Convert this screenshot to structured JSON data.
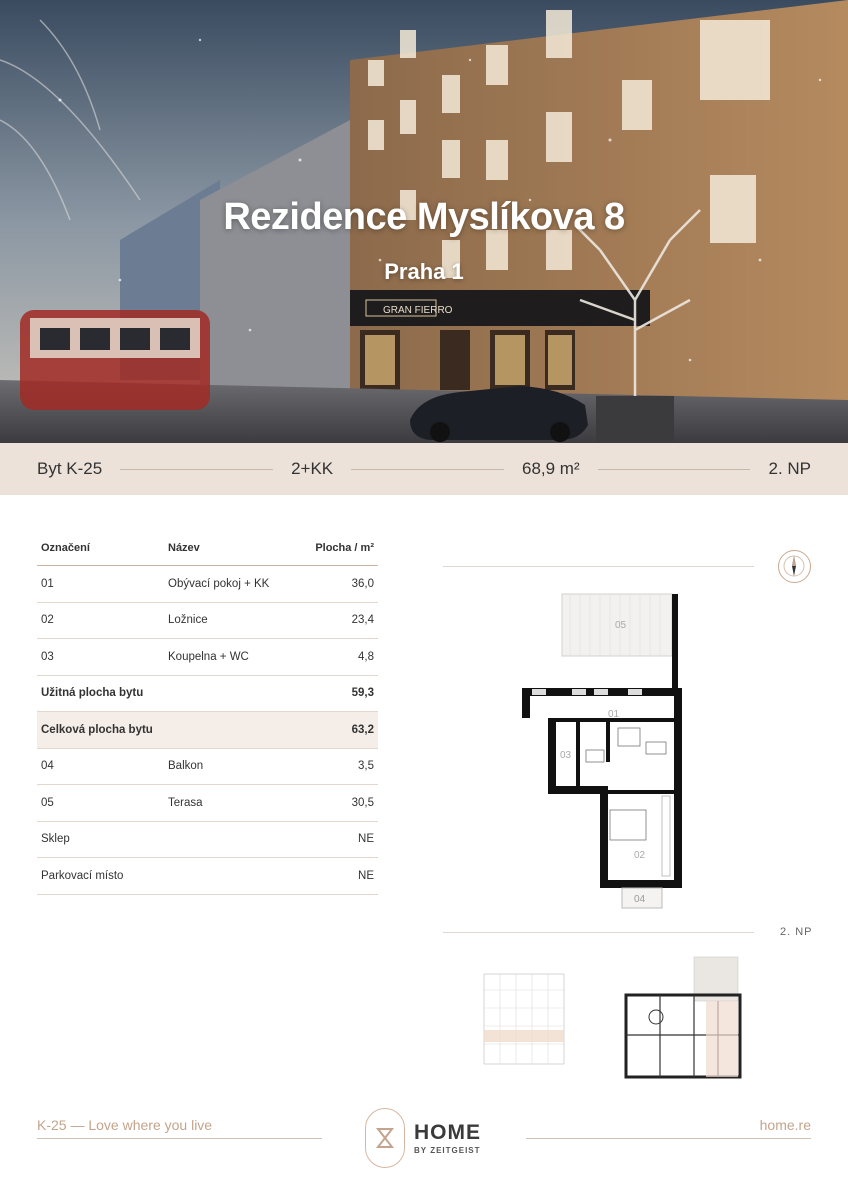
{
  "hero": {
    "title": "Rezidence Myslíkova 8",
    "subtitle": "Praha 1",
    "shop_sign": "GRAN FIERRO"
  },
  "info": {
    "unit": "Byt K-25",
    "layout": "2+KK",
    "area": "68,9 m²",
    "floor": "2. NP"
  },
  "table": {
    "headers": [
      "Označení",
      "Název",
      "Plocha / m²"
    ],
    "rows": [
      {
        "id": "01",
        "name": "Obývací pokoj + KK",
        "area": "36,0"
      },
      {
        "id": "02",
        "name": "Ložnice",
        "area": "23,4"
      },
      {
        "id": "03",
        "name": "Koupelna + WC",
        "area": "4,8"
      }
    ],
    "usable": {
      "label": "Užitná plocha bytu",
      "area": "59,3"
    },
    "total": {
      "label": "Celková plocha bytu",
      "area": "63,2"
    },
    "extras": [
      {
        "id": "04",
        "name": "Balkon",
        "area": "3,5"
      },
      {
        "id": "05",
        "name": "Terasa",
        "area": "30,5"
      }
    ],
    "sklep": {
      "label": "Sklep",
      "value": "NE"
    },
    "parking": {
      "label": "Parkovací místo",
      "value": "NE"
    }
  },
  "plan": {
    "room_labels": [
      "01",
      "02",
      "03",
      "04",
      "05"
    ],
    "floor": "2. NP"
  },
  "footer": {
    "left": "K-25 — Love where you live",
    "brand": "HOME",
    "brand_sub": "BY ZEITGEIST",
    "right": "home.re"
  },
  "colors": {
    "accent": "#c4a48c",
    "band": "#ece2da",
    "highlight": "#f4ede8"
  }
}
